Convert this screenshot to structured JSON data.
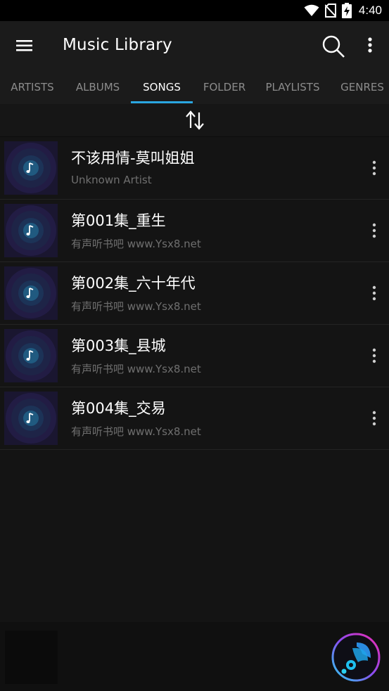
{
  "status_bar": {
    "time": "4:40",
    "icons": [
      "wifi-icon",
      "no-sim-icon",
      "battery-charging-icon"
    ]
  },
  "app_bar": {
    "title": "Music Library",
    "icons": [
      "hamburger-menu-icon",
      "search-icon",
      "more-vert-icon"
    ]
  },
  "tabs": [
    {
      "label": "ARTISTS",
      "active": false
    },
    {
      "label": "ALBUMS",
      "active": false
    },
    {
      "label": "SONGS",
      "active": true
    },
    {
      "label": "FOLDER",
      "active": false
    },
    {
      "label": "PLAYLISTS",
      "active": false
    },
    {
      "label": "GENRES",
      "active": false
    }
  ],
  "sort_bar": {
    "icon": "sort-arrows-icon"
  },
  "songs": [
    {
      "title": "不该用情-莫叫姐姐",
      "artist": "Unknown Artist"
    },
    {
      "title": "第001集_重生",
      "artist": "有声听书吧 www.Ysx8.net"
    },
    {
      "title": "第002集_六十年代",
      "artist": "有声听书吧 www.Ysx8.net"
    },
    {
      "title": "第003集_县城",
      "artist": "有声听书吧 www.Ysx8.net"
    },
    {
      "title": "第004集_交易",
      "artist": "有声听书吧 www.Ysx8.net"
    }
  ],
  "colors": {
    "accent": "#2aa6e0",
    "background": "#141414",
    "toolbar": "#1b1b1b",
    "secondary_text": "#6f6f6f"
  }
}
